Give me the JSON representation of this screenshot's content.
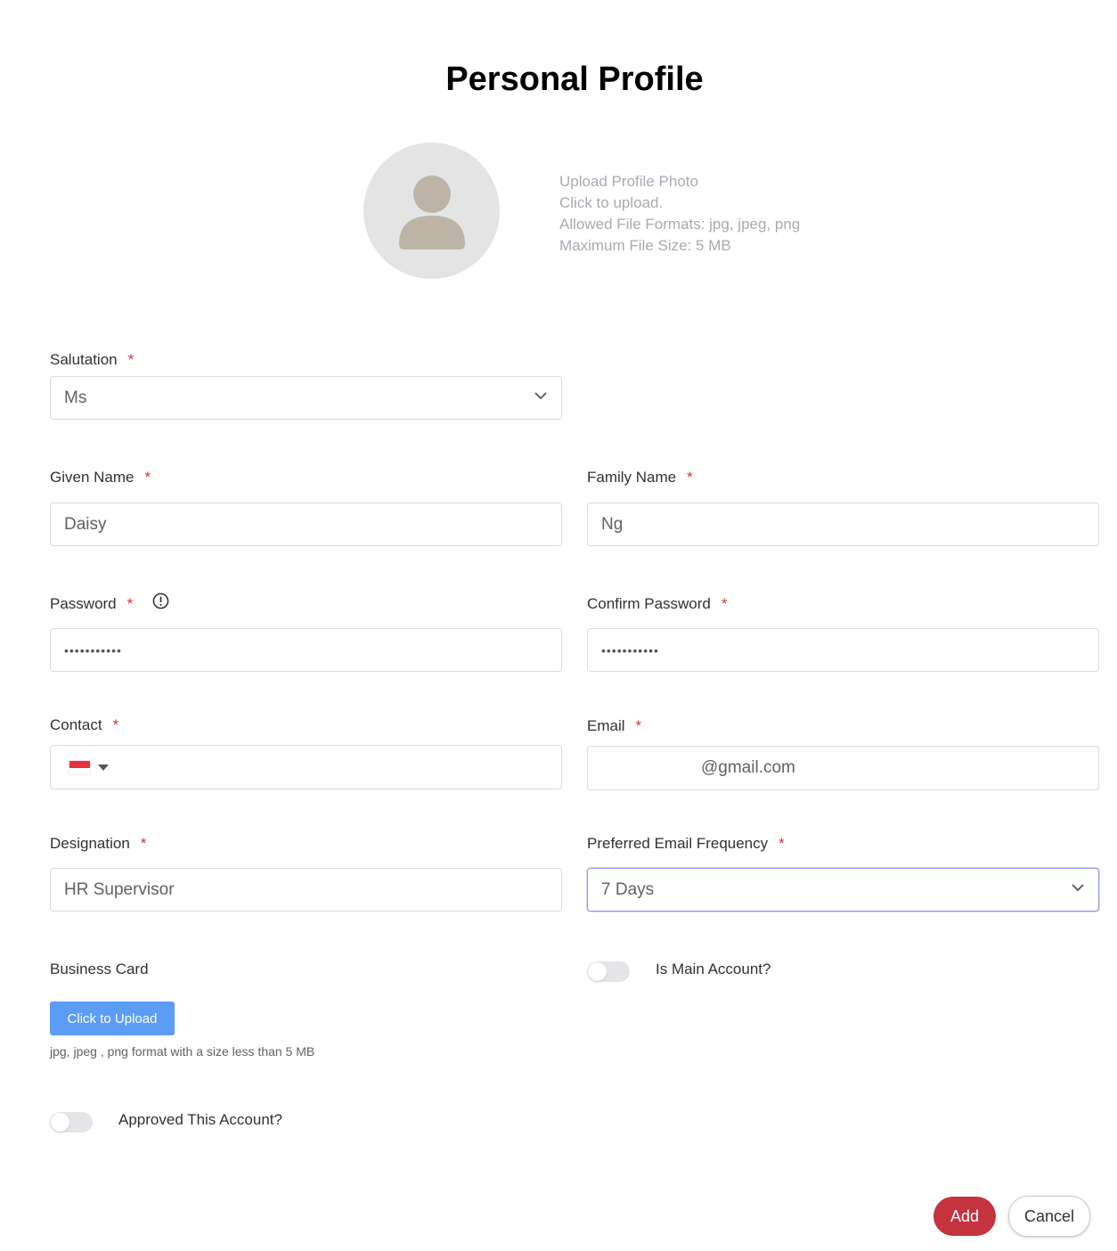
{
  "title": "Personal Profile",
  "photo_upload": {
    "line1": "Upload Profile Photo",
    "line2": "Click to upload.",
    "line3": "Allowed File Formats: jpg, jpeg, png",
    "line4": "Maximum File Size: 5 MB"
  },
  "required_mark": "*",
  "salutation": {
    "label": "Salutation",
    "value": "Ms"
  },
  "given_name": {
    "label": "Given Name",
    "value": "Daisy"
  },
  "family_name": {
    "label": "Family Name",
    "value": "Ng"
  },
  "password": {
    "label": "Password",
    "value": "•••••••••••"
  },
  "confirm_password": {
    "label": "Confirm Password",
    "value": "•••••••••••"
  },
  "contact": {
    "label": "Contact",
    "value": ""
  },
  "email": {
    "label": "Email",
    "value": "@gmail.com"
  },
  "designation": {
    "label": "Designation",
    "value": "HR Supervisor"
  },
  "email_frequency": {
    "label": "Preferred Email Frequency",
    "value": "7 Days"
  },
  "business_card": {
    "label": "Business Card",
    "button": "Click to Upload",
    "hint": "jpg, jpeg , png format with a size less than 5 MB"
  },
  "is_main_account": {
    "label": "Is Main Account?",
    "on": false
  },
  "approved_account": {
    "label": "Approved This Account?",
    "on": false
  },
  "actions": {
    "add": "Add",
    "cancel": "Cancel"
  },
  "colors": {
    "primary": "#c4333e",
    "upload": "#5b9cf5",
    "required": "#d0343a"
  }
}
